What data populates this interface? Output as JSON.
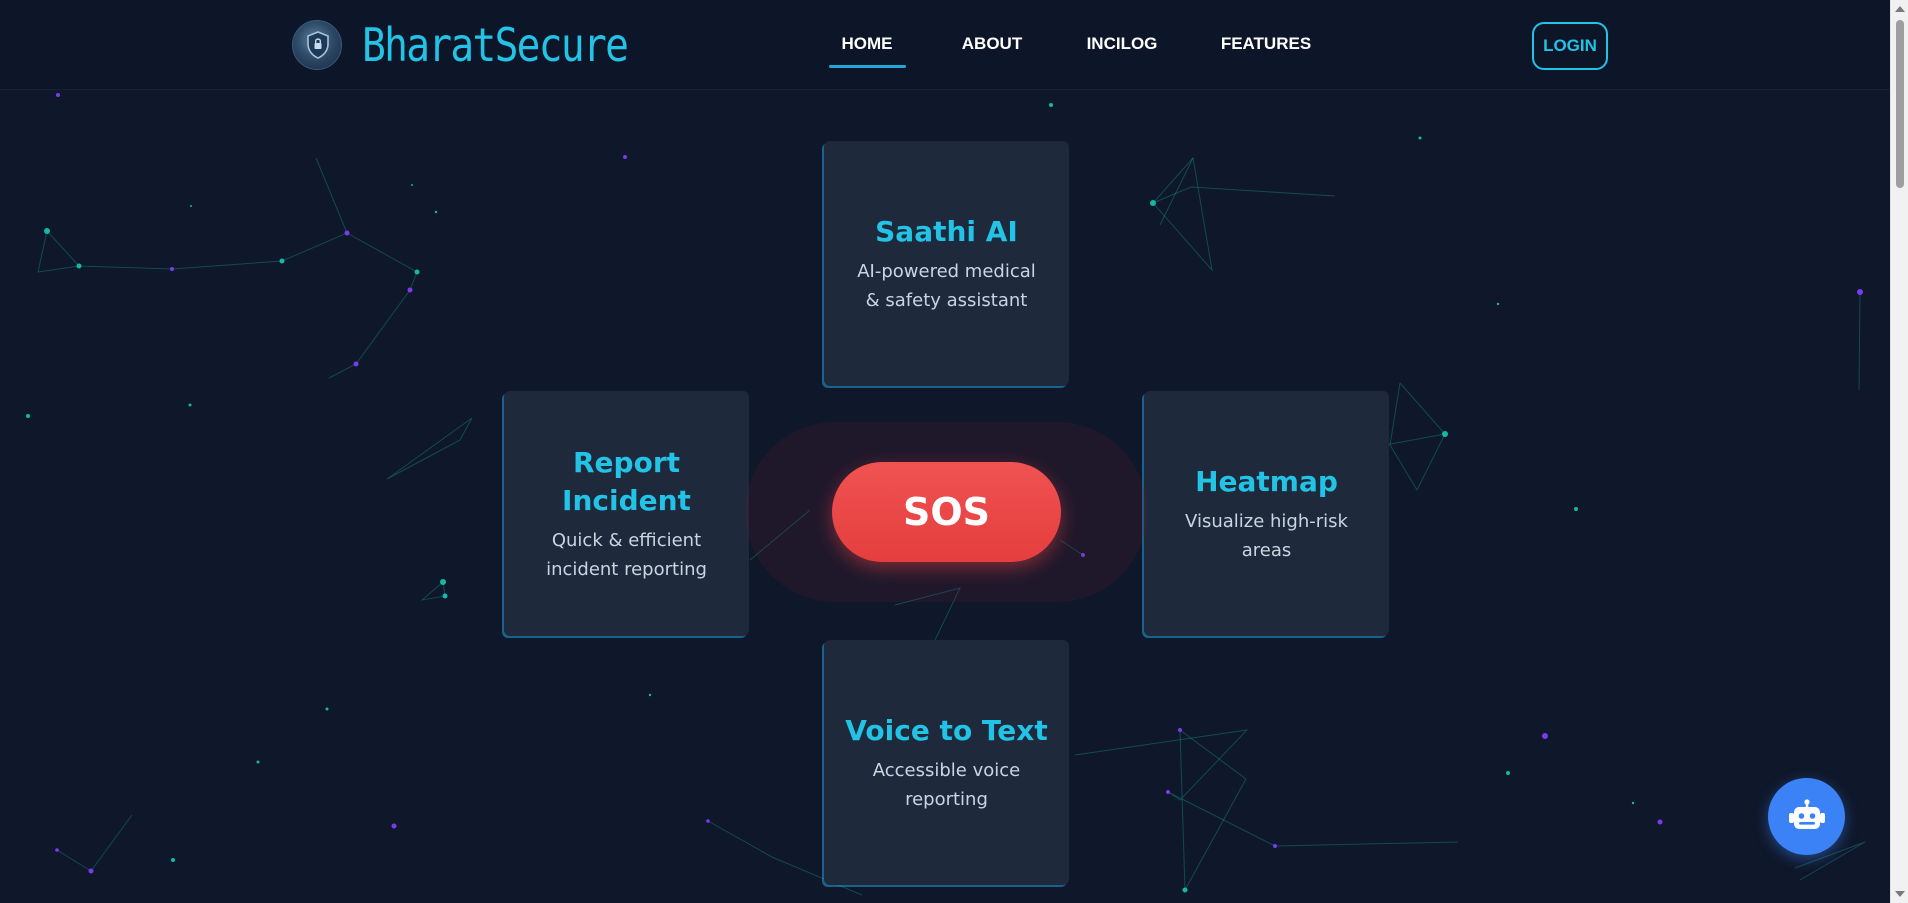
{
  "brand": {
    "name": "BharatSecure",
    "logo": "shield-logo-icon"
  },
  "nav": {
    "home": "HOME",
    "about": "ABOUT",
    "incilog": "INCILOG",
    "features": "FEATURES",
    "active": "HOME"
  },
  "login": {
    "label": "LOGIN"
  },
  "features": {
    "top": {
      "title": "Saathi AI",
      "desc_line1": "AI-powered medical",
      "desc_line2": "& safety assistant"
    },
    "left": {
      "title_line1": "Report",
      "title_line2": "Incident",
      "desc_line1": "Quick & efficient",
      "desc_line2": "incident reporting"
    },
    "right": {
      "title": "Heatmap",
      "desc_line1": "Visualize high-risk",
      "desc_line2": "areas"
    },
    "bottom": {
      "title": "Voice to Text",
      "desc_line1": "Accessible voice",
      "desc_line2": "reporting"
    }
  },
  "sos": {
    "label": "SOS"
  },
  "chatbot": {
    "icon": "robot-icon"
  },
  "colors": {
    "background": "#0f172a",
    "accent": "#22c3e6",
    "card": "#1e293b",
    "sos": "#ef4444",
    "chat_button": "#3b82f6",
    "particle_teal": "#14b8a6",
    "particle_purple": "#7c3aed"
  }
}
